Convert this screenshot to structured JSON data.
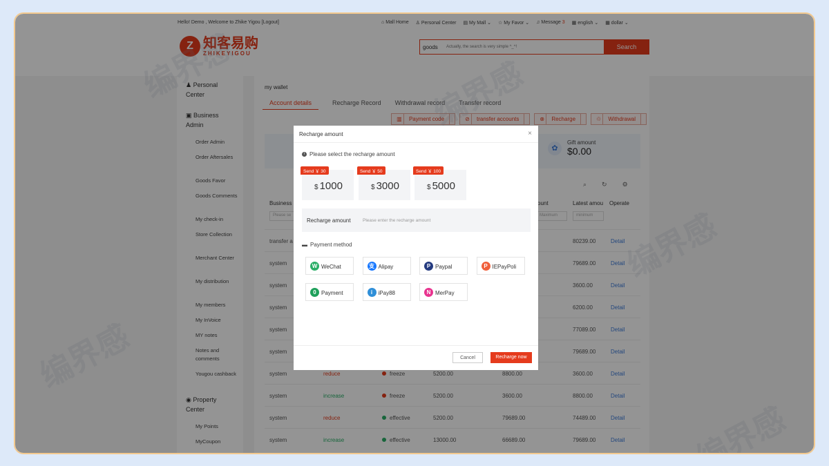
{
  "topbar": {
    "greeting": "Hello! Demo , Welcome to Zhike Yigou [Logout]",
    "links": [
      "Mall Home",
      "Personal Center",
      "My Mall ⌄",
      "My Favor ⌄",
      "Message",
      "english ⌄",
      "dollar ⌄"
    ],
    "message_count": "3"
  },
  "logo": {
    "cn": "知客易购",
    "en": "ZHIKEYIGOU",
    "mark": "Z"
  },
  "search": {
    "category": "goods",
    "placeholder": "Actually, the search is very simple ^_^!",
    "button": "Search"
  },
  "sidebar": {
    "sections": [
      "Personal Center",
      "Business Admin",
      "Property Center"
    ],
    "items": [
      "Order Admin",
      "Order Aftersales",
      "Goods Favor",
      "Goods Comments",
      "My check-in",
      "Store Collection",
      "Merchant Center",
      "My distribution",
      "My members",
      "My InVoice",
      "MY notes",
      "Notes and comments",
      "Yougou cashback",
      "My Points",
      "MyCoupon"
    ]
  },
  "main": {
    "title": "my wallet",
    "tabs": [
      "Account details",
      "Recharge Record",
      "Withdrawal record",
      "Transfer record"
    ],
    "actions": [
      "Payment code",
      "transfer accounts",
      "Recharge",
      "Withdrawal"
    ],
    "gift_label": "Gift amount",
    "gift_value": "$0.00"
  },
  "table": {
    "headers": [
      "Business",
      "ount",
      "Latest amou",
      "Operate"
    ],
    "filters": [
      "Please se",
      "Maximum",
      "minimum"
    ],
    "rows": [
      {
        "business": "transfer a",
        "type": "",
        "status": "",
        "amount": "",
        "before": "",
        "latest": "80239.00",
        "op": "Detail"
      },
      {
        "business": "system",
        "type": "",
        "status": "",
        "amount": "",
        "before": "",
        "latest": "79689.00",
        "op": "Detail"
      },
      {
        "business": "system",
        "type": "",
        "status": "",
        "amount": "",
        "before": "",
        "latest": "3600.00",
        "op": "Detail"
      },
      {
        "business": "system",
        "type": "",
        "status": "",
        "amount": "",
        "before": "",
        "latest": "6200.00",
        "op": "Detail"
      },
      {
        "business": "system",
        "type": "",
        "status": "",
        "amount": "",
        "before": "",
        "latest": "77089.00",
        "op": "Detail"
      },
      {
        "business": "system",
        "type": "",
        "status": "",
        "amount": "",
        "before": "",
        "latest": "79689.00",
        "op": "Detail"
      },
      {
        "business": "system",
        "type": "reduce",
        "status": "freeze",
        "amount": "5200.00",
        "before": "8800.00",
        "latest": "3600.00",
        "op": "Detail"
      },
      {
        "business": "system",
        "type": "increase",
        "status": "freeze",
        "amount": "5200.00",
        "before": "3600.00",
        "latest": "8800.00",
        "op": "Detail"
      },
      {
        "business": "system",
        "type": "reduce",
        "status": "effective",
        "amount": "5200.00",
        "before": "79689.00",
        "latest": "74489.00",
        "op": "Detail"
      },
      {
        "business": "system",
        "type": "increase",
        "status": "effective",
        "amount": "13000.00",
        "before": "66689.00",
        "latest": "79689.00",
        "op": "Detail"
      }
    ]
  },
  "modal": {
    "title": "Recharge amount",
    "close": "×",
    "select_label": "Please select the recharge amount",
    "amounts": [
      {
        "badge": "Send ￥ 30",
        "currency": "$",
        "value": "1000"
      },
      {
        "badge": "Send ￥ 50",
        "currency": "$",
        "value": "3000"
      },
      {
        "badge": "Send ￥ 100",
        "currency": "$",
        "value": "5000"
      }
    ],
    "input_label": "Recharge amount",
    "input_placeholder": "Please enter the recharge amount",
    "payment_label": "Payment method",
    "methods": [
      {
        "name": "WeChat",
        "icon": "wechat-icon",
        "color": "#2aae67",
        "glyph": "W"
      },
      {
        "name": "Alipay",
        "icon": "alipay-icon",
        "color": "#1677ff",
        "glyph": "支"
      },
      {
        "name": "Paypal",
        "icon": "paypal-icon",
        "color": "#253b80",
        "glyph": "P"
      },
      {
        "name": "IEPayPoli",
        "icon": "iepaypoli-icon",
        "color": "#f0603b",
        "glyph": "P"
      },
      {
        "name": "Payment",
        "icon": "payment-icon",
        "color": "#1ea05a",
        "glyph": "0"
      },
      {
        "name": "iPay88",
        "icon": "ipay88-icon",
        "color": "#2f8fd8",
        "glyph": "i"
      },
      {
        "name": "MerPay",
        "icon": "merpay-icon",
        "color": "#e8338f",
        "glyph": "N"
      }
    ],
    "cancel": "Cancel",
    "submit": "Recharge now"
  },
  "colors": {
    "accent": "#e53b1d",
    "link": "#3c7ad8",
    "increase": "#2aae67",
    "reduce": "#e53b1d"
  }
}
